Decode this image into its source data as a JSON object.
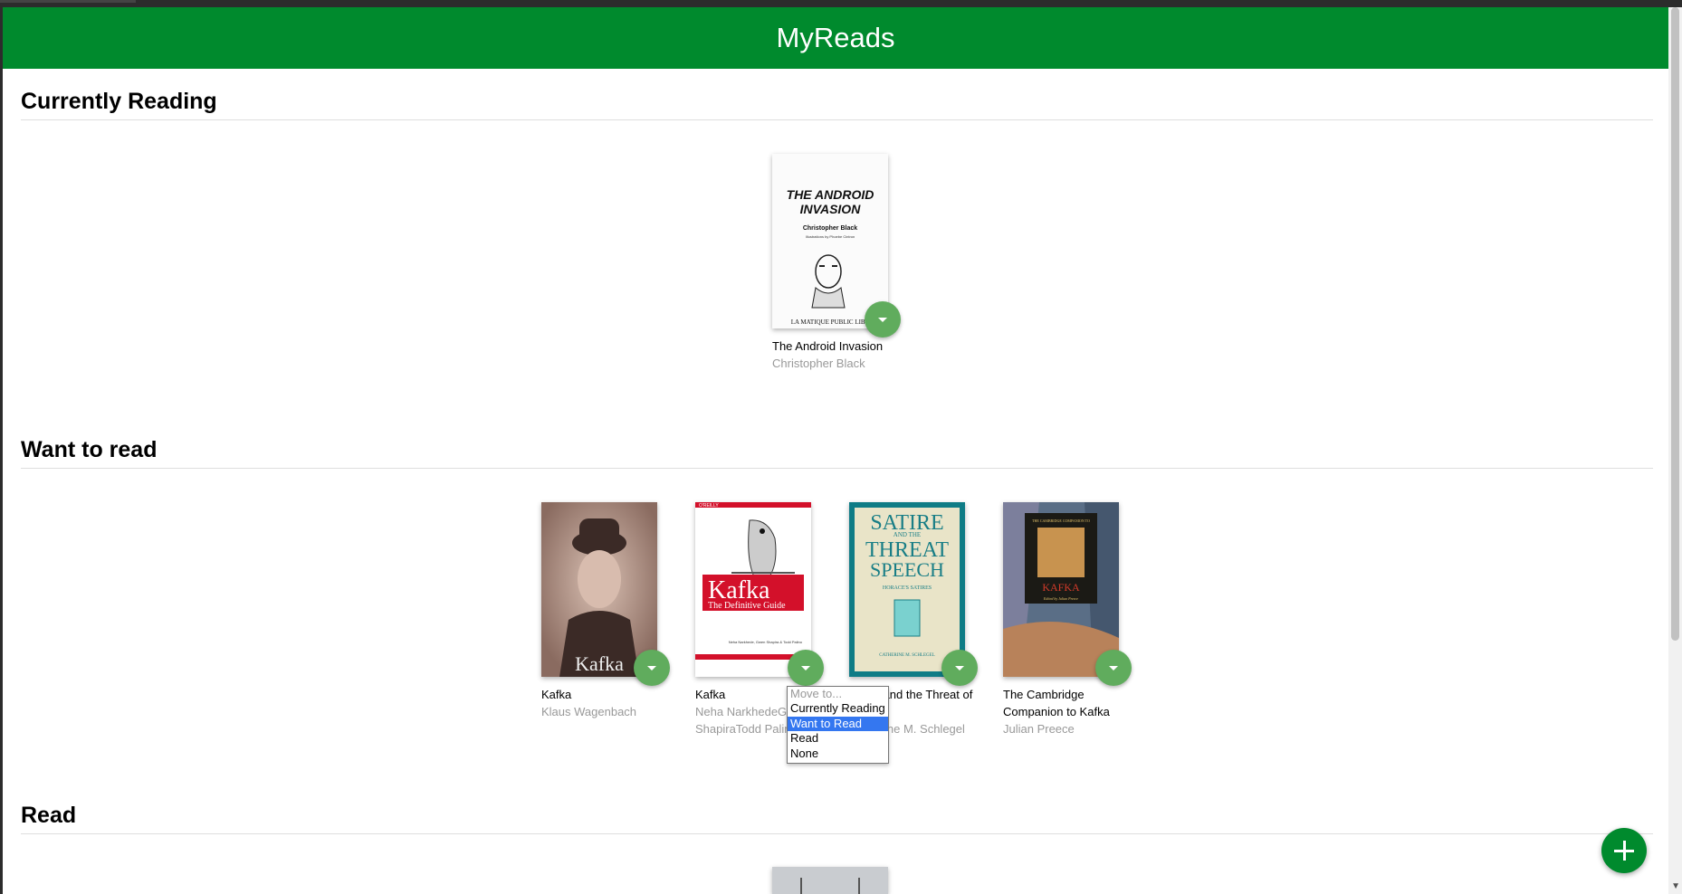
{
  "app": {
    "title": "MyReads",
    "accent": "#008a2d",
    "button_color": "#60ac5d"
  },
  "shelves": [
    {
      "title": "Currently Reading",
      "books": [
        {
          "title": "The Android Invasion",
          "authors": "Christopher Black",
          "cover": {
            "line1": "THE ANDROID",
            "line2": "INVASION",
            "author": "Christopher Black",
            "sub": "Illustrations by Phoebe Cintron",
            "footer": "LA MATIQUE PUBLIC LIBR"
          }
        }
      ]
    },
    {
      "title": "Want to read",
      "books": [
        {
          "title": "Kafka",
          "authors": "Klaus Wagenbach",
          "cover": {
            "text": "Kafka"
          }
        },
        {
          "title": "Kafka",
          "authors": "Neha NarkhedeGwen ShapiraTodd Palino",
          "cover": {
            "publisher": "O'REILLY",
            "big": "Kafka",
            "sub": "The Definitive Guide",
            "authors": "Neha Narkhede, Gwen Shapira & Todd Palino"
          }
        },
        {
          "title": "Satire and the Threat of Speech",
          "authors": "Catherine M. Schlegel",
          "cover": {
            "l1": "SATIRE",
            "l2": "AND THE",
            "l3": "THREAT",
            "l4": "SPEECH",
            "l5": "HORACE'S SATIRES",
            "l6": "CATHERINE M. SCHLEGEL"
          }
        },
        {
          "title": "The Cambridge Companion to Kafka",
          "authors": "Julian Preece",
          "cover": {
            "top": "THE CAMBRIDGE COMPANION TO",
            "big": "KAFKA",
            "ed": "Edited by Julian Preece"
          }
        }
      ]
    },
    {
      "title": "Read",
      "books": []
    }
  ],
  "move_menu": {
    "placeholder": "Move to...",
    "options": [
      "Currently Reading",
      "Want to Read",
      "Read",
      "None"
    ],
    "selected": "Want to Read"
  },
  "icons": {
    "shelf_changer": "caret-down-icon",
    "add": "plus-icon"
  }
}
